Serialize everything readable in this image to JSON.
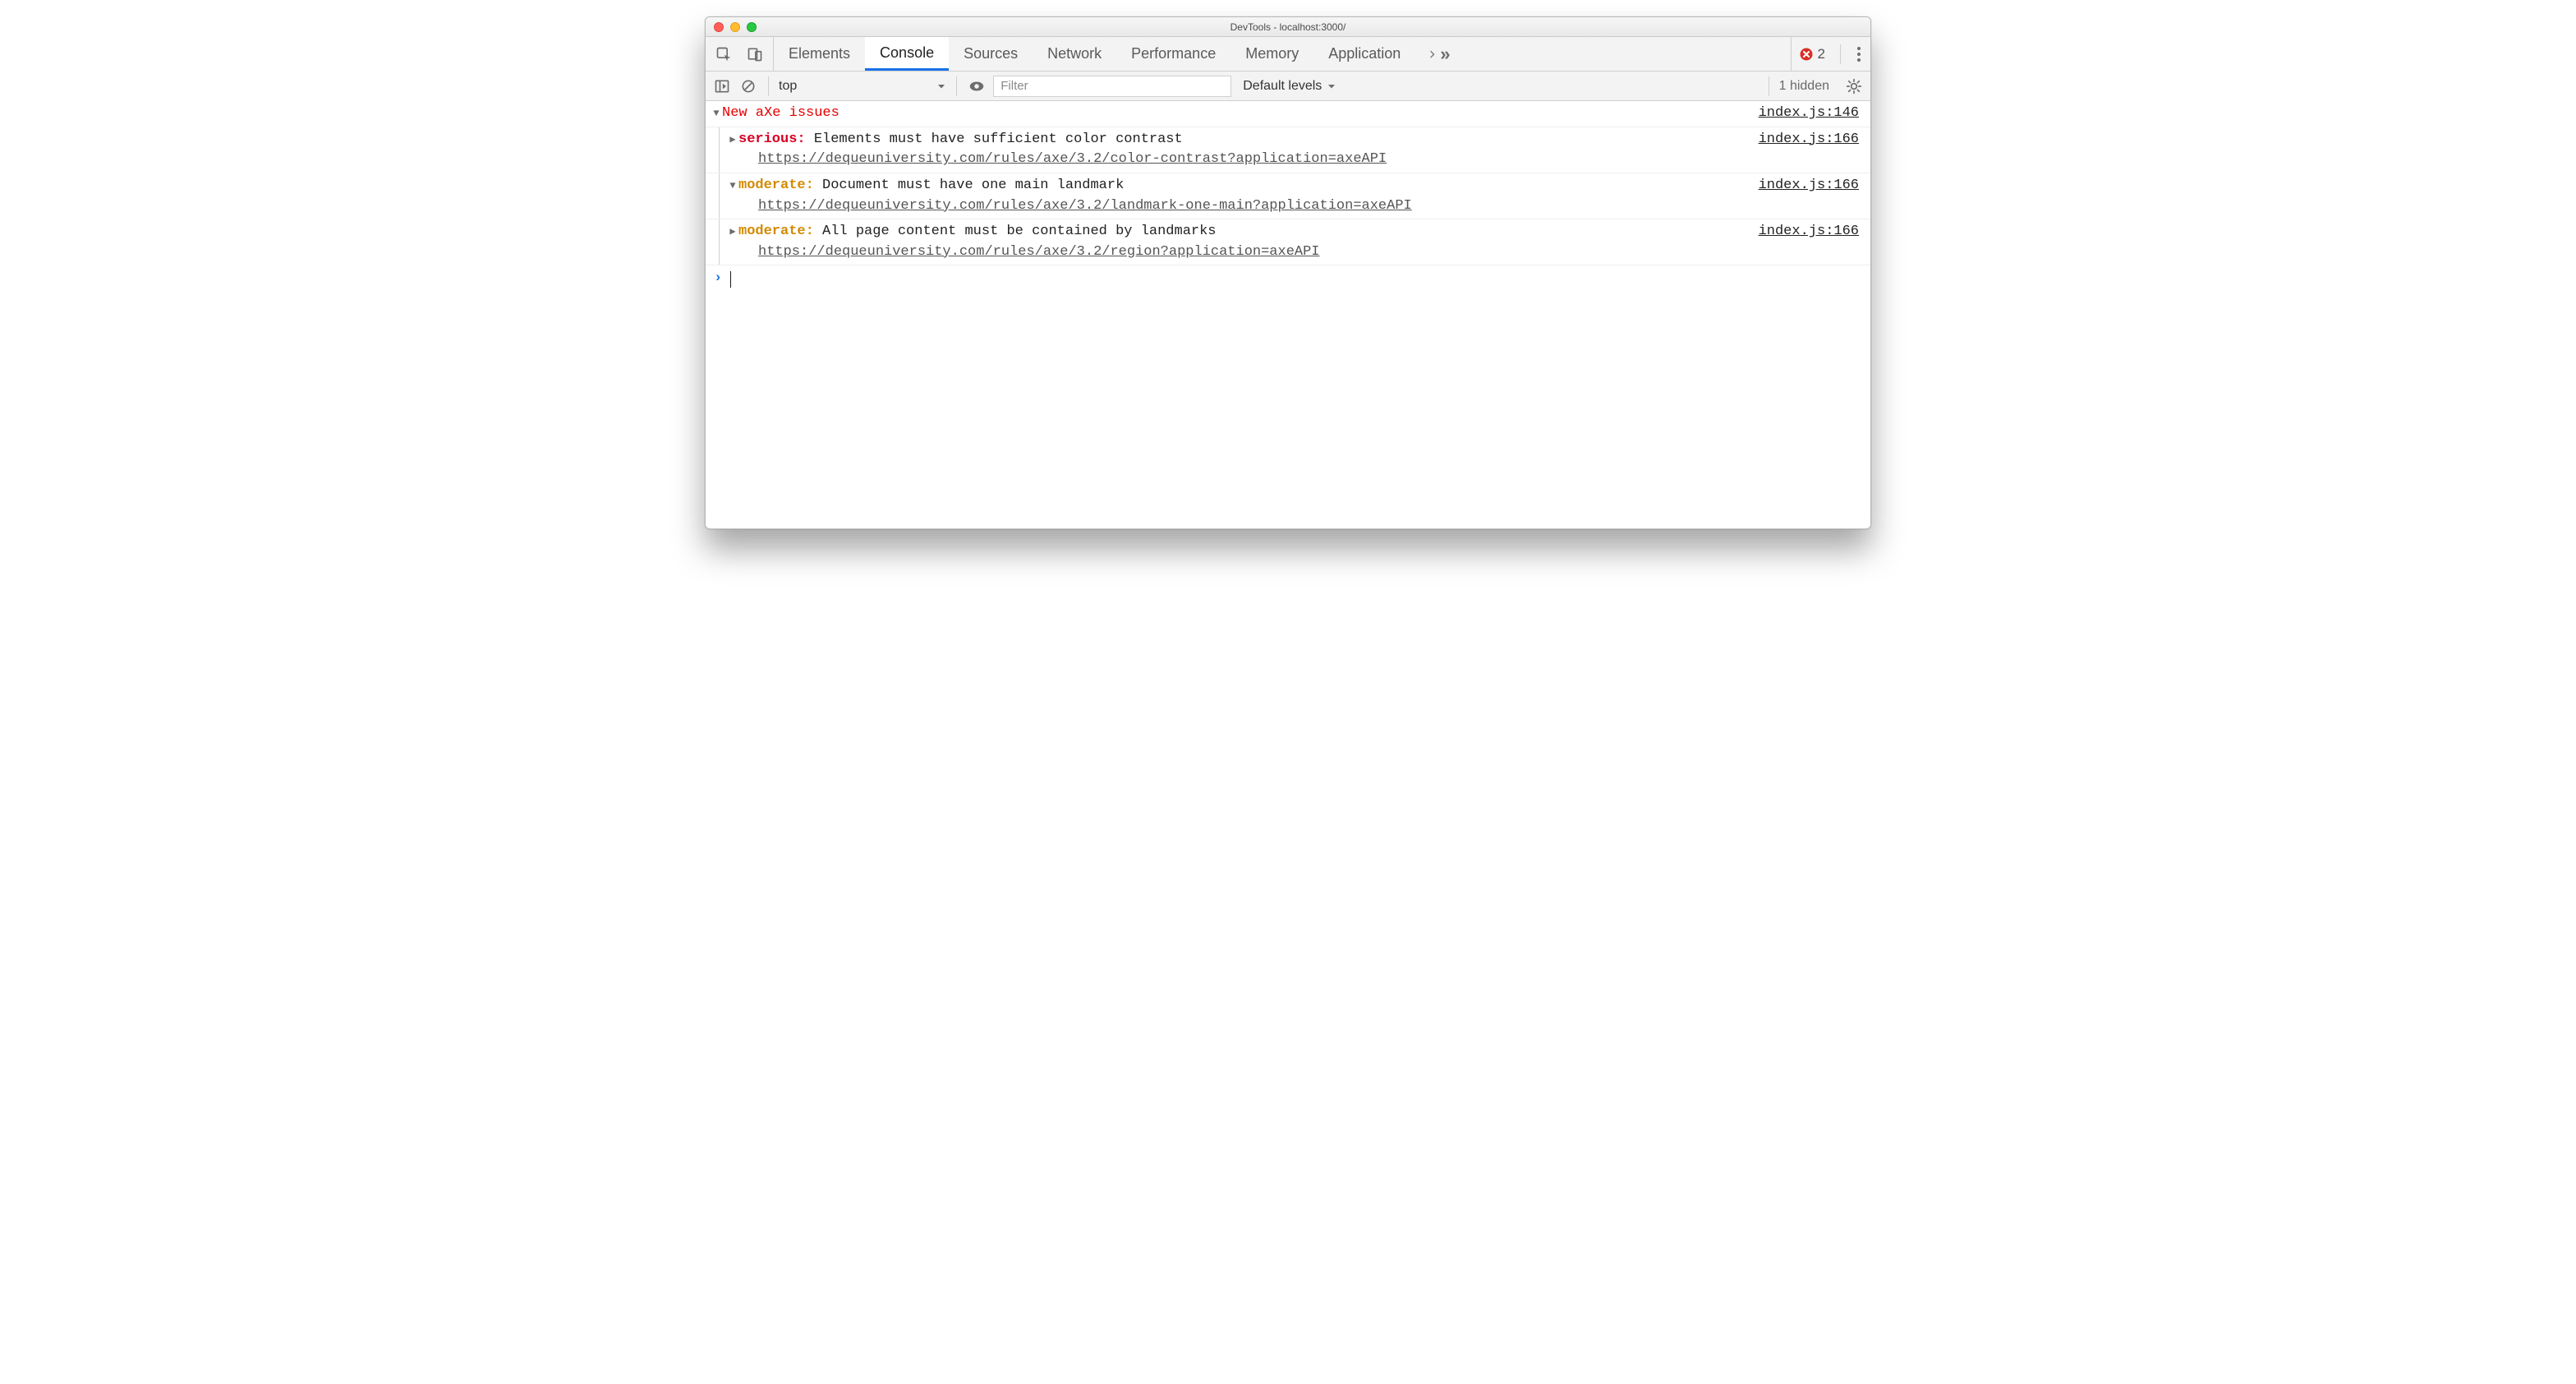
{
  "window": {
    "title": "DevTools - localhost:3000/"
  },
  "tabs": {
    "items": [
      "Elements",
      "Console",
      "Sources",
      "Network",
      "Performance",
      "Memory",
      "Application"
    ],
    "active_index": 1,
    "error_count": "2"
  },
  "toolbar": {
    "context": "top",
    "filter_placeholder": "Filter",
    "levels_label": "Default levels",
    "hidden_label": "1 hidden"
  },
  "console": {
    "group_label": "New aXe issues",
    "group_src": "index.js:146",
    "rows": [
      {
        "expanded": false,
        "severity": "serious",
        "severity_label": "serious:",
        "message": "Elements must have sufficient color contrast",
        "link": "https://dequeuniversity.com/rules/axe/3.2/color-contrast?application=axeAPI",
        "src": "index.js:166"
      },
      {
        "expanded": true,
        "severity": "moderate",
        "severity_label": "moderate:",
        "message": "Document must have one main landmark",
        "link": "https://dequeuniversity.com/rules/axe/3.2/landmark-one-main?application=axeAPI",
        "src": "index.js:166"
      },
      {
        "expanded": false,
        "severity": "moderate",
        "severity_label": "moderate:",
        "message": "All page content must be contained by landmarks",
        "link": "https://dequeuniversity.com/rules/axe/3.2/region?application=axeAPI",
        "src": "index.js:166"
      }
    ]
  }
}
